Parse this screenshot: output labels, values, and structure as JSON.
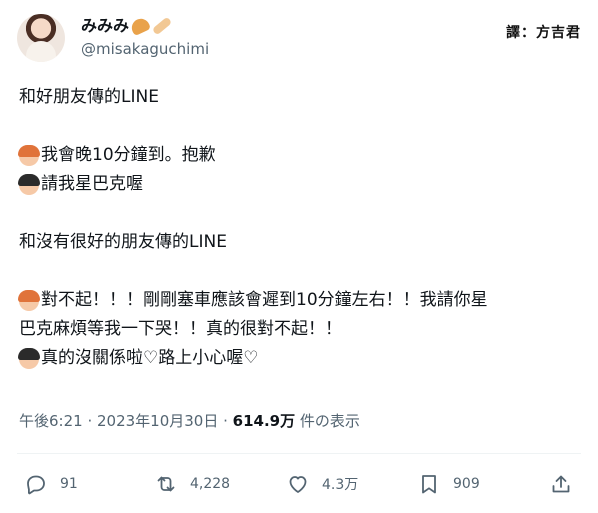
{
  "author": {
    "display_name": "みみみ",
    "handle": "@misakaguchimi"
  },
  "watermark": "譯：方吉君",
  "tweet": {
    "line1": "和好朋友傳的LINE",
    "line2": "我會晚10分鐘到。抱歉",
    "line3": "請我星巴克喔",
    "line4": "和沒有很好的朋友傳的LINE",
    "line5": "對不起！！！剛剛塞車應該會遲到10分鐘左右！！我請你星",
    "line6": "巴克麻煩等我一下哭！！真的很對不起！！",
    "line7": "真的沒關係啦♡路上小心喔♡"
  },
  "meta": {
    "time": "午後6:21 · 2023年10月30日 · ",
    "views_count": "614.9万",
    "views_label": " 件の表示"
  },
  "actions": {
    "replies": "91",
    "retweets": "4,228",
    "likes": "4.3万",
    "bookmarks": "909"
  },
  "icons": {
    "reply": "reply-icon",
    "retweet": "retweet-icon",
    "like": "heart-icon",
    "bookmark": "bookmark-icon",
    "share": "share-icon"
  },
  "colors": {
    "text": "#0f1419",
    "secondary": "#536471"
  }
}
